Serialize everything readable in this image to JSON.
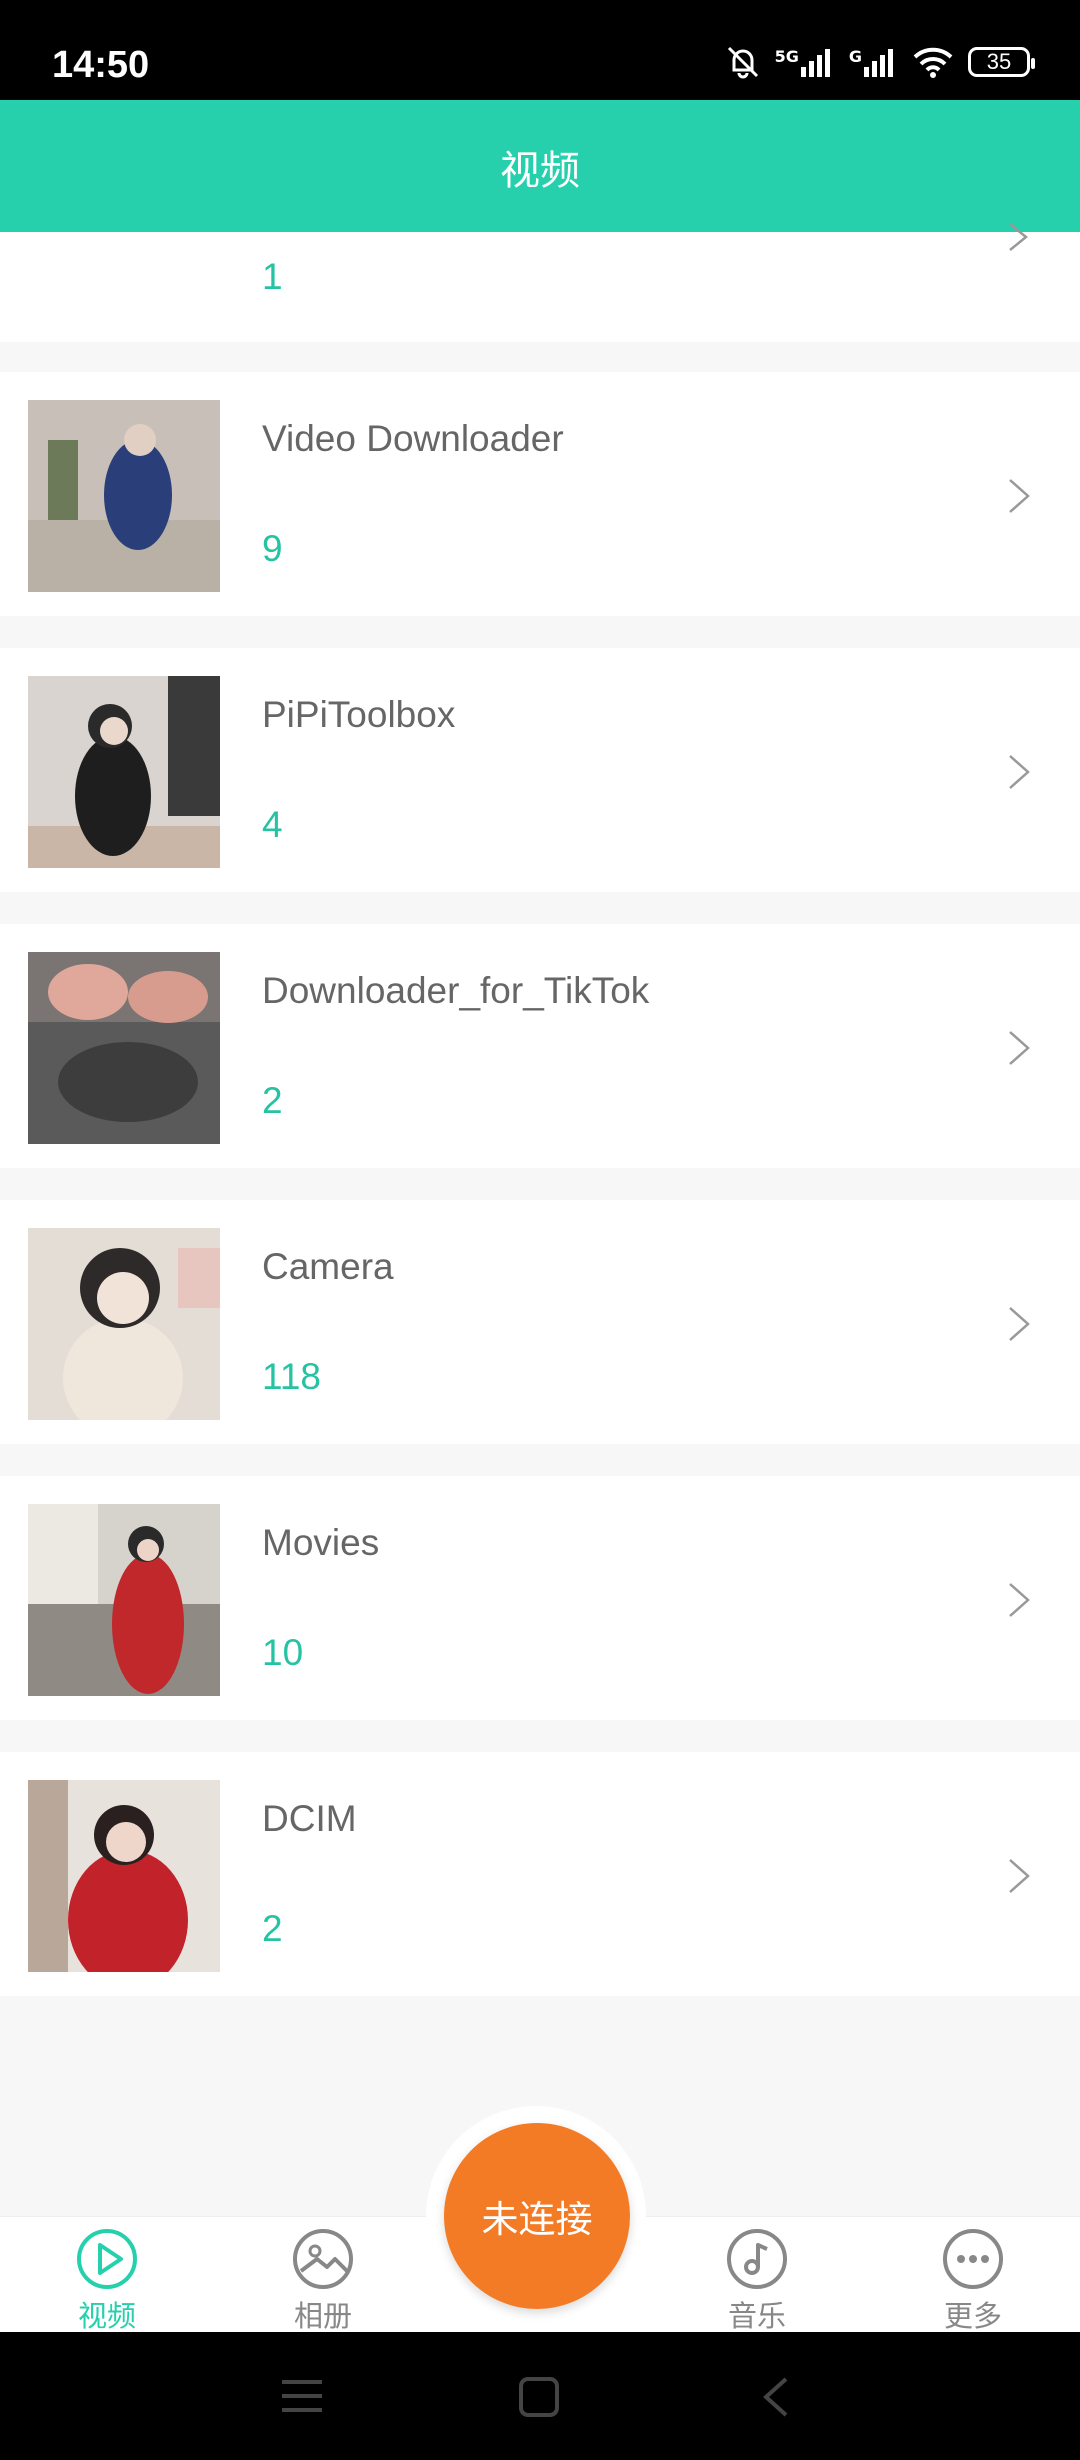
{
  "status_bar": {
    "time": "14:50",
    "battery": "35",
    "net1": "5G",
    "net2": "G"
  },
  "header": {
    "title": "视频"
  },
  "partial_row": {
    "count": "1"
  },
  "folders": [
    {
      "name": "Video Downloader",
      "count": "9",
      "thumb_colors": [
        "#c8c0b8",
        "#2a3f7a",
        "#d8d0c8"
      ]
    },
    {
      "name": "PiPiToolbox",
      "count": "4",
      "thumb_colors": [
        "#d9d4cf",
        "#1e1e1e",
        "#c9b6a6"
      ]
    },
    {
      "name": "Downloader_for_TikTok",
      "count": "2",
      "thumb_colors": [
        "#5a5a5a",
        "#e0a89a",
        "#3d3d3d"
      ]
    },
    {
      "name": "Camera",
      "count": "118",
      "thumb_colors": [
        "#e4ddd6",
        "#efe7dc",
        "#2e2a2a"
      ]
    },
    {
      "name": "Movies",
      "count": "10",
      "thumb_colors": [
        "#d6d2cc",
        "#c0282c",
        "#8f8a84"
      ]
    },
    {
      "name": "DCIM",
      "count": "2",
      "thumb_colors": [
        "#e8e2dc",
        "#c2232a",
        "#b9a79a"
      ]
    }
  ],
  "tabs": [
    {
      "label": "视频",
      "icon": "play-circle-icon",
      "active": true
    },
    {
      "label": "相册",
      "icon": "album-icon",
      "active": false
    },
    {
      "label": "音乐",
      "icon": "music-icon",
      "active": false
    },
    {
      "label": "更多",
      "icon": "more-icon",
      "active": false
    }
  ],
  "connect_button": {
    "label": "未连接"
  },
  "colors": {
    "accent": "#26d0ac",
    "count": "#26c3a3",
    "connect": "#f47b25"
  }
}
